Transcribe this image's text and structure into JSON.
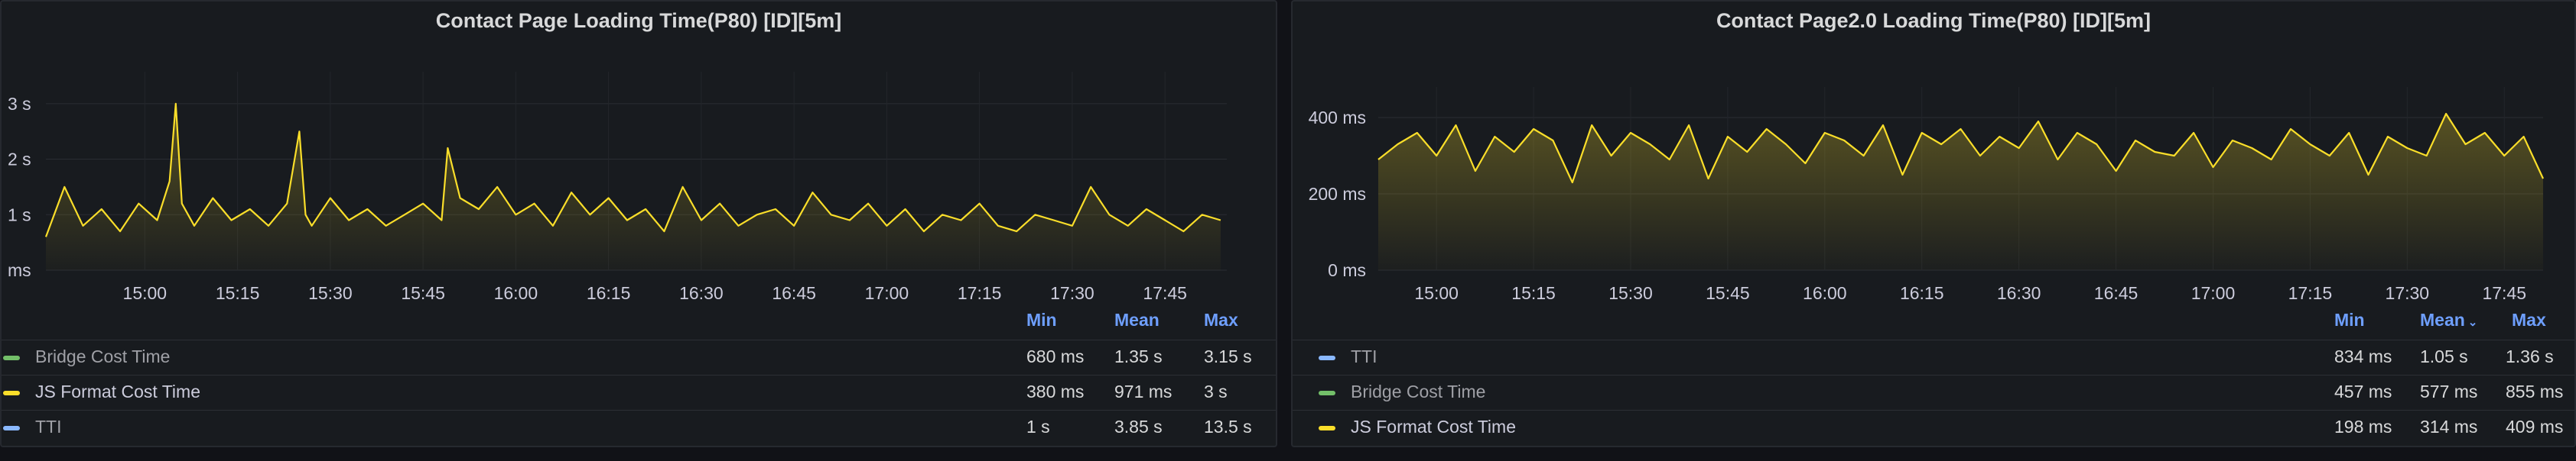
{
  "panels": [
    {
      "title": "Contact Page Loading Time(P80) [ID][5m]",
      "chart_data": {
        "type": "line",
        "x_ticks": [
          "15:00",
          "15:15",
          "15:30",
          "15:45",
          "16:00",
          "16:15",
          "16:30",
          "16:45",
          "17:00",
          "17:15",
          "17:30",
          "17:45"
        ],
        "y_ticks": [
          "ms",
          "1 s",
          "2 s",
          "3 s"
        ],
        "y_unit": "s",
        "ylim": [
          0,
          3.3
        ],
        "xlim": [
          "14:44",
          "17:55"
        ],
        "series": [
          {
            "name": "JS Format Cost Time",
            "color": "#fade2a",
            "x": [
              "14:44",
              "14:47",
              "14:50",
              "14:53",
              "14:56",
              "14:59",
              "15:02",
              "15:04",
              "15:05",
              "15:06",
              "15:08",
              "15:11",
              "15:14",
              "15:17",
              "15:20",
              "15:23",
              "15:25",
              "15:26",
              "15:27",
              "15:30",
              "15:33",
              "15:36",
              "15:39",
              "15:42",
              "15:45",
              "15:48",
              "15:49",
              "15:51",
              "15:54",
              "15:57",
              "16:00",
              "16:03",
              "16:06",
              "16:09",
              "16:12",
              "16:15",
              "16:18",
              "16:21",
              "16:24",
              "16:27",
              "16:30",
              "16:33",
              "16:36",
              "16:39",
              "16:42",
              "16:45",
              "16:48",
              "16:51",
              "16:54",
              "16:57",
              "17:00",
              "17:03",
              "17:06",
              "17:09",
              "17:12",
              "17:15",
              "17:18",
              "17:21",
              "17:24",
              "17:27",
              "17:30",
              "17:33",
              "17:36",
              "17:39",
              "17:42",
              "17:45",
              "17:48",
              "17:51",
              "17:54"
            ],
            "y": [
              0.6,
              1.5,
              0.8,
              1.1,
              0.7,
              1.2,
              0.9,
              1.6,
              3.0,
              1.2,
              0.8,
              1.3,
              0.9,
              1.1,
              0.8,
              1.2,
              2.5,
              1.0,
              0.8,
              1.3,
              0.9,
              1.1,
              0.8,
              1.0,
              1.2,
              0.9,
              2.2,
              1.3,
              1.1,
              1.5,
              1.0,
              1.2,
              0.8,
              1.4,
              1.0,
              1.3,
              0.9,
              1.1,
              0.7,
              1.5,
              0.9,
              1.2,
              0.8,
              1.0,
              1.1,
              0.8,
              1.4,
              1.0,
              0.9,
              1.2,
              0.8,
              1.1,
              0.7,
              1.0,
              0.9,
              1.2,
              0.8,
              0.7,
              1.0,
              0.9,
              0.8,
              1.5,
              1.0,
              0.8,
              1.1,
              0.9,
              0.7,
              1.0,
              0.9
            ]
          }
        ]
      },
      "legend": {
        "headers": {
          "min": "Min",
          "mean": "Mean",
          "max": "Max"
        },
        "rows": [
          {
            "name": "Bridge Cost Time",
            "color": "#73bf69",
            "min": "680 ms",
            "mean": "1.35 s",
            "max": "3.15 s",
            "dim": true
          },
          {
            "name": "JS Format Cost Time",
            "color": "#fade2a",
            "min": "380 ms",
            "mean": "971 ms",
            "max": "3 s",
            "dim": false
          },
          {
            "name": "TTI",
            "color": "#8ab8ff",
            "min": "1 s",
            "mean": "3.85 s",
            "max": "13.5 s",
            "dim": true
          }
        ]
      }
    },
    {
      "title": "Contact Page2.0 Loading Time(P80) [ID][5m]",
      "chart_data": {
        "type": "line",
        "x_ticks": [
          "15:00",
          "15:15",
          "15:30",
          "15:45",
          "16:00",
          "16:15",
          "16:30",
          "16:45",
          "17:00",
          "17:15",
          "17:30",
          "17:45"
        ],
        "y_ticks": [
          "0 ms",
          "200 ms",
          "400 ms"
        ],
        "y_unit": "ms",
        "ylim": [
          0,
          440
        ],
        "xlim": [
          "14:51",
          "17:51"
        ],
        "series": [
          {
            "name": "JS Format Cost Time",
            "color": "#fade2a",
            "x": [
              "14:51",
              "14:54",
              "14:57",
              "15:00",
              "15:03",
              "15:06",
              "15:09",
              "15:12",
              "15:15",
              "15:18",
              "15:21",
              "15:24",
              "15:27",
              "15:30",
              "15:33",
              "15:36",
              "15:39",
              "15:42",
              "15:45",
              "15:48",
              "15:51",
              "15:54",
              "15:57",
              "16:00",
              "16:03",
              "16:06",
              "16:09",
              "16:12",
              "16:15",
              "16:18",
              "16:21",
              "16:24",
              "16:27",
              "16:30",
              "16:33",
              "16:36",
              "16:39",
              "16:42",
              "16:45",
              "16:48",
              "16:51",
              "16:54",
              "16:57",
              "17:00",
              "17:03",
              "17:06",
              "17:09",
              "17:12",
              "17:15",
              "17:18",
              "17:21",
              "17:24",
              "17:27",
              "17:30",
              "17:33",
              "17:36",
              "17:39",
              "17:42",
              "17:45",
              "17:48",
              "17:51"
            ],
            "y": [
              290,
              330,
              360,
              300,
              380,
              260,
              350,
              310,
              370,
              340,
              230,
              380,
              300,
              360,
              330,
              290,
              380,
              240,
              350,
              310,
              370,
              330,
              280,
              360,
              340,
              300,
              380,
              250,
              360,
              330,
              370,
              300,
              350,
              320,
              390,
              290,
              360,
              330,
              260,
              340,
              310,
              300,
              360,
              270,
              340,
              320,
              290,
              370,
              330,
              300,
              360,
              250,
              350,
              320,
              300,
              410,
              330,
              360,
              300,
              350,
              240
            ]
          }
        ]
      },
      "legend": {
        "headers": {
          "min": "Min",
          "mean": "Mean",
          "max": "Max"
        },
        "rows": [
          {
            "name": "TTI",
            "color": "#8ab8ff",
            "min": "834 ms",
            "mean": "1.05 s",
            "max": "1.36 s",
            "dim": true
          },
          {
            "name": "Bridge Cost Time",
            "color": "#73bf69",
            "min": "457 ms",
            "mean": "577 ms",
            "max": "855 ms",
            "dim": true
          },
          {
            "name": "JS Format Cost Time",
            "color": "#fade2a",
            "min": "198 ms",
            "mean": "314 ms",
            "max": "409 ms",
            "dim": false
          }
        ]
      }
    }
  ]
}
